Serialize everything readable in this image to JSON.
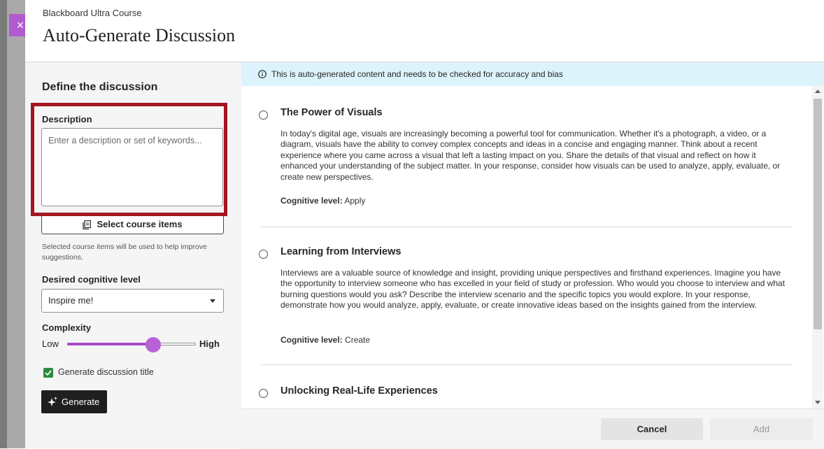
{
  "header": {
    "course_name": "Blackboard Ultra Course",
    "title": "Auto-Generate Discussion",
    "close_symbol": "×"
  },
  "form": {
    "heading": "Define the discussion",
    "description_label": "Description",
    "description_placeholder": "Enter a description or set of keywords...",
    "description_value": "",
    "select_items_label": "Select course items",
    "select_items_hint": "Selected course items will be used to help improve suggestions.",
    "cognitive_label": "Desired cognitive level",
    "cognitive_value": "Inspire me!",
    "complexity_label": "Complexity",
    "complexity_low": "Low",
    "complexity_high": "High",
    "complexity_level": 0.67,
    "generate_title_label": "Generate discussion title",
    "generate_title_checked": true,
    "generate_button": "Generate"
  },
  "banner": {
    "text": "This is auto-generated content and needs to be checked for accuracy and bias"
  },
  "results": [
    {
      "title": "The Power of Visuals",
      "body": "In today's digital age, visuals are increasingly becoming a powerful tool for communication. Whether it's a photograph, a video, or a diagram, visuals have the ability to convey complex concepts and ideas in a concise and engaging manner. Think about a recent experience where you came across a visual that left a lasting impact on you. Share the details of that visual and reflect on how it enhanced your understanding of the subject matter. In your response, consider how visuals can be used to analyze, apply, evaluate, or create new perspectives.",
      "cognitive_label": "Cognitive level:",
      "cognitive_value": "Apply"
    },
    {
      "title": "Learning from Interviews",
      "body": "Interviews are a valuable source of knowledge and insight, providing unique perspectives and firsthand experiences. Imagine you have the opportunity to interview someone who has excelled in your field of study or profession. Who would you choose to interview and what burning questions would you ask? Describe the interview scenario and the specific topics you would explore. In your response, demonstrate how you would analyze, apply, evaluate, or create innovative ideas based on the insights gained from the interview.",
      "cognitive_label": "Cognitive level:",
      "cognitive_value": "Create"
    },
    {
      "title": "Unlocking Real-Life Experiences"
    }
  ],
  "footer": {
    "cancel": "Cancel",
    "add": "Add"
  },
  "colors": {
    "accent_purple": "#b15bd0",
    "highlight_red": "#a31621",
    "banner_blue": "#ddf3fb",
    "checkbox_green": "#2b8a3e"
  }
}
